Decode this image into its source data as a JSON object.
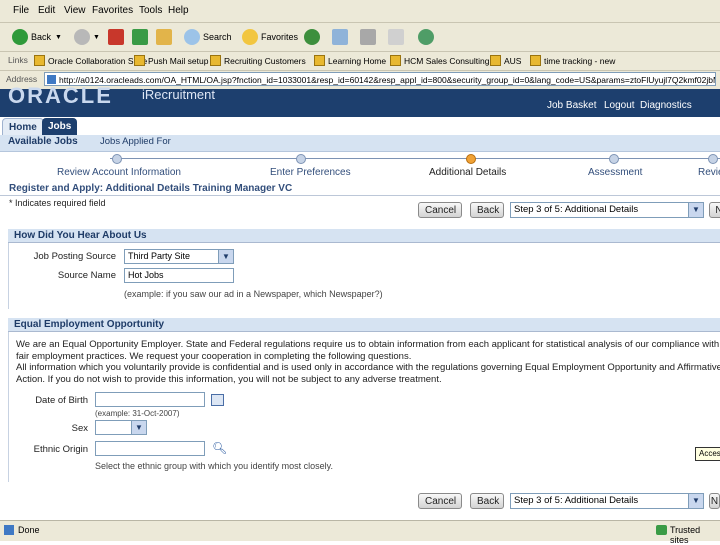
{
  "browser": {
    "menu": [
      "File",
      "Edit",
      "View",
      "Favorites",
      "Tools",
      "Help"
    ],
    "toolbar": {
      "back": "Back",
      "search": "Search",
      "favorites": "Favorites"
    },
    "links_label": "Links",
    "links": [
      "Oracle Collaboration Suite",
      "Push Mail setup",
      "Recruiting Customers",
      "Learning Home",
      "HCM Sales Consulting",
      "AUS",
      "time tracking - new"
    ],
    "address_label": "Address",
    "address_value": "http://a0124.oracleads.com/OA_HTML/OA.jsp?fnction_id=1033001&resp_id=60142&resp_appl_id=800&security_group_id=0&lang_code=US&params=ztoFlUyujl7Q2kmf02jbM",
    "status_text": "Done",
    "zone_text": "Trusted sites"
  },
  "header": {
    "logo": "ORACLE",
    "app_name": "iRecruitment",
    "global_links": [
      "Job Basket",
      "Logout",
      "Diagnostics"
    ]
  },
  "tabs": [
    "Home",
    "Jobs"
  ],
  "subtabs": [
    "Available Jobs",
    "Jobs Applied For"
  ],
  "train": [
    "Review Account Information",
    "Enter Preferences",
    "Additional Details",
    "Assessment",
    "Review"
  ],
  "page_title": "Register and Apply: Additional Details Training Manager VC",
  "required_note": "* Indicates required field",
  "actions": {
    "cancel": "Cancel",
    "back": "Back",
    "step": "Step 3 of 5: Additional Details",
    "next": "N"
  },
  "hear_about": {
    "heading": "How Did You Hear About Us",
    "source_label": "Job Posting Source",
    "source_value": "Third Party Site",
    "name_label": "Source Name",
    "name_value": "Hot Jobs",
    "hint": "(example: if you saw our ad in a Newspaper, which Newspaper?)"
  },
  "eeo": {
    "heading": "Equal Employment Opportunity",
    "text": [
      "We are an Equal Opportunity Employer. State and Federal regulations require us to obtain information from each applicant for statistical analysis of our compliance with",
      "fair employment practices. We request your cooperation in completing the following questions.",
      "All information which you voluntarily provide is confidential and is used only in accordance with the regulations governing Equal Employment Opportunity and Affirmative",
      "Action. If you do not wish to provide this information, you will not be subject to any adverse treatment."
    ],
    "dob_label": "Date of Birth",
    "dob_hint": "(example: 31-Oct-2007)",
    "sex_label": "Sex",
    "ethnic_label": "Ethnic Origin",
    "ethnic_hint": "Select the ethnic group with which you identify most closely.",
    "tooltip": "Access"
  },
  "colors": {
    "brand": "#1d3f6e",
    "accent": "#324e7b",
    "section": "#d6e3f2"
  }
}
